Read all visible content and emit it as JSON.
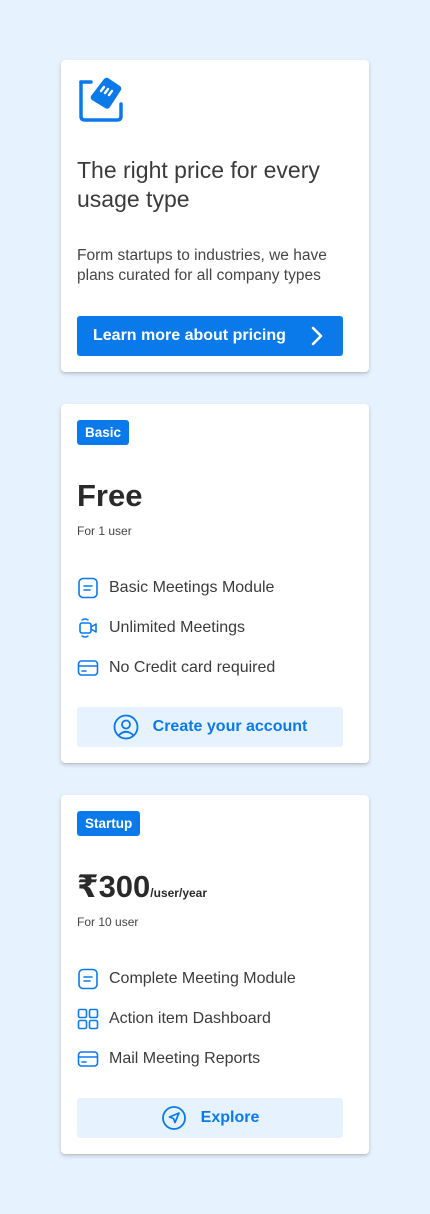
{
  "colors": {
    "accent": "#0a7aeb",
    "background": "#e6f2fd",
    "card": "#ffffff"
  },
  "intro": {
    "icon": "price-tag-icon",
    "title": "The right price for every usage type",
    "description": "Form startups to industries, we have plans curated for all company types",
    "cta_label": "Learn more about pricing",
    "cta_icon": "chevron-right-icon"
  },
  "plans": [
    {
      "badge": "Basic",
      "price": "Free",
      "unit": "",
      "subtitle": "For 1 user",
      "features": [
        {
          "icon": "document-icon",
          "label": "Basic Meetings Module"
        },
        {
          "icon": "video-camera-icon",
          "label": "Unlimited Meetings"
        },
        {
          "icon": "credit-card-icon",
          "label": "No Credit card required"
        }
      ],
      "cta_label": "Create your account",
      "cta_icon": "user-circle-icon"
    },
    {
      "badge": "Startup",
      "price": "₹300",
      "unit": "/user/year",
      "subtitle": "For 10 user",
      "features": [
        {
          "icon": "document-icon",
          "label": "Complete Meeting Module"
        },
        {
          "icon": "grid-icon",
          "label": "Action item Dashboard"
        },
        {
          "icon": "credit-card-icon",
          "label": "Mail Meeting Reports"
        }
      ],
      "cta_label": "Explore",
      "cta_icon": "navigation-arrow-icon"
    }
  ]
}
